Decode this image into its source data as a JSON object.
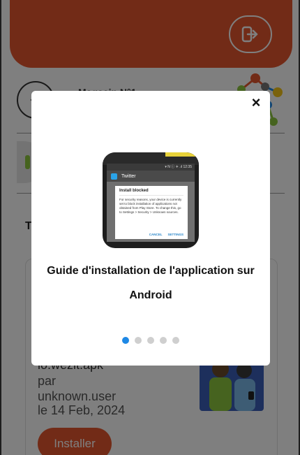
{
  "header": {
    "logout_icon": "logout-icon"
  },
  "shop": {
    "title": "Magasin N°1",
    "back_icon": "arrow-left-icon"
  },
  "section": {
    "letter": "T"
  },
  "app_card": {
    "file_name": "io.wezit.apk",
    "by_label": "par",
    "author": "unknown.user",
    "date": "le 14 Feb, 2024",
    "install_label": "Installer"
  },
  "modal": {
    "close_label": "×",
    "title": "Guide d'installation de l'application sur Android",
    "slides_total": 5,
    "active_slide": 1,
    "phone": {
      "status": "▾ N ⓘ ✈ .ıl 12:35",
      "app_name": "Twitter",
      "dialog_title": "Install blocked",
      "dialog_body": "For security reasons, your device is currently set to block installation of applications not obtained from Play Store. To change this, go to Settings > Security > Unknown sources.",
      "cancel_label": "CANCEL",
      "settings_label": "SETTINGS"
    }
  },
  "colors": {
    "accent": "#e4572e",
    "dot_active": "#1e88e5",
    "dot_inactive": "#cfcfcf"
  }
}
